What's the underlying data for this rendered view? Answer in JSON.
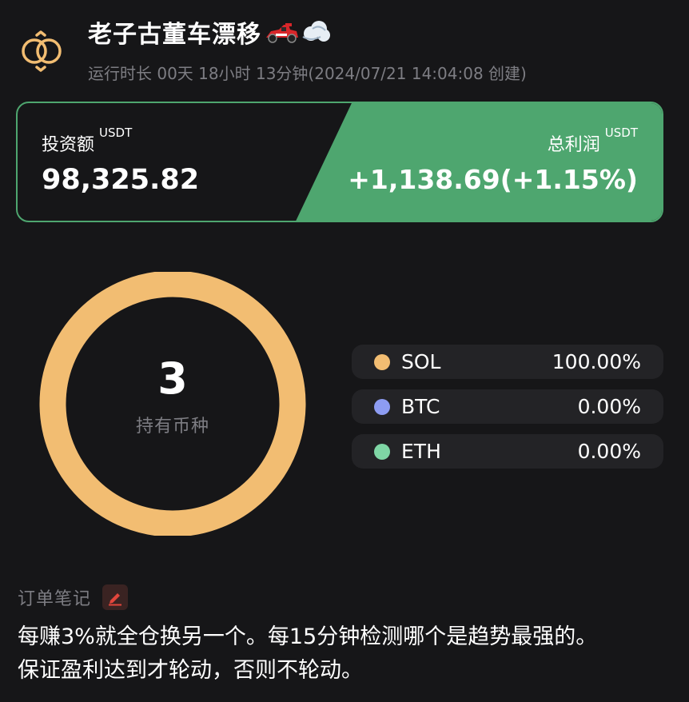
{
  "header": {
    "title": "老子古董车漂移",
    "emoji_icons": [
      "race-car-icon",
      "dash-cloud-icon"
    ],
    "subtitle": "运行时长 00天 18小时 13分钟(2024/07/21 14:04:08 创建)"
  },
  "summary": {
    "investment_label": "投资额",
    "investment_unit": "USDT",
    "investment_value": "98,325.82",
    "profit_label": "总利润",
    "profit_unit": "USDT",
    "profit_value": "+1,138.69(+1.15%)"
  },
  "holdings": {
    "count": "3",
    "count_label": "持有币种",
    "items": [
      {
        "name": "SOL",
        "percent": "100.00%",
        "value": 100.0,
        "color": "#f2bd72"
      },
      {
        "name": "BTC",
        "percent": "0.00%",
        "value": 0.0,
        "color": "#8d9cf2"
      },
      {
        "name": "ETH",
        "percent": "0.00%",
        "value": 0.0,
        "color": "#7fd6a5"
      }
    ]
  },
  "notes": {
    "title": "订单笔记",
    "lines": [
      "每赚3%就全仓换另一个。每15分钟检测哪个是趋势最强的。",
      "保证盈利达到才轮动，否则不轮动。"
    ]
  },
  "colors": {
    "background": "#161618",
    "accent_green": "#4ea66f",
    "logo_gold": "#f2bd72",
    "edit_red": "#e2463c"
  }
}
